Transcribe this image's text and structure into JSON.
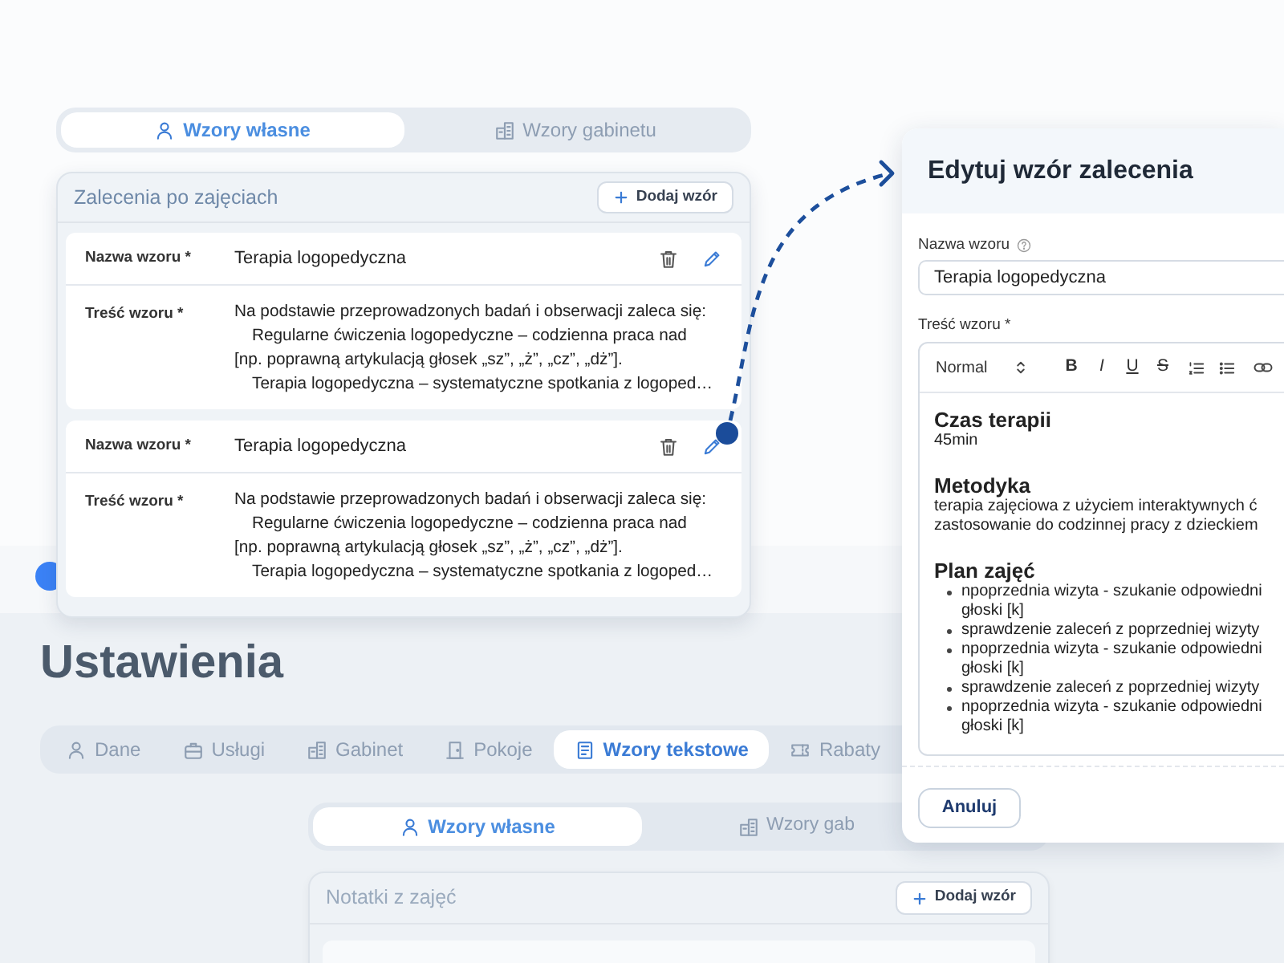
{
  "background_page": {
    "heading": "Ustawienia",
    "tabs": [
      {
        "label": "Dane",
        "selected": false
      },
      {
        "label": "Usługi",
        "selected": false
      },
      {
        "label": "Gabinet",
        "selected": false
      },
      {
        "label": "Pokoje",
        "selected": false
      },
      {
        "label": "Wzory tekstowe",
        "selected": true
      },
      {
        "label": "Rabaty",
        "selected": false
      }
    ],
    "subtabs": [
      {
        "label": "Wzory własne",
        "selected": true
      },
      {
        "label": "Wzory gab",
        "selected": false
      }
    ],
    "card": {
      "title": "Notatki z zajęć",
      "add_button": "Dodaj wzór"
    }
  },
  "template_panel": {
    "subtabs": [
      {
        "label": "Wzory własne",
        "selected": true
      },
      {
        "label": "Wzory gabinetu",
        "selected": false
      }
    ],
    "card": {
      "title": "Zalecenia po zajęciach",
      "add_button": "Dodaj wzór",
      "templates": [
        {
          "name_label": "Nazwa wzoru *",
          "name": "Terapia logopedyczna",
          "content_label": "Treść wzoru *",
          "content_lines": [
            {
              "text": "Na podstawie przeprowadzonych badań i obserwacji zaleca się:",
              "indented": false
            },
            {
              "text": "Regularne ćwiczenia logopedyczne – codzienna praca nad",
              "indented": true
            },
            {
              "text": "[np. poprawną artykulacją głosek „sz”, „ż”, „cz”, „dż”].",
              "indented": false
            },
            {
              "text": "Terapia logopedyczna – systematyczne spotkania z logoped…",
              "indented": true
            }
          ]
        },
        {
          "name_label": "Nazwa wzoru *",
          "name": "Terapia logopedyczna",
          "content_label": "Treść wzoru *",
          "content_lines": [
            {
              "text": "Na podstawie przeprowadzonych badań i obserwacji zaleca się:",
              "indented": false
            },
            {
              "text": "Regularne ćwiczenia logopedyczne – codzienna praca nad",
              "indented": true
            },
            {
              "text": "[np. poprawną artykulacją głosek „sz”, „ż”, „cz”, „dż”].",
              "indented": false
            },
            {
              "text": "Terapia logopedyczna – systematyczne spotkania z logoped…",
              "indented": true
            }
          ]
        }
      ]
    }
  },
  "edit_panel": {
    "title": "Edytuj wzór zalecenia",
    "name_label": "Nazwa wzoru",
    "name_value": "Terapia logopedyczna",
    "content_label": "Treść wzoru *",
    "toolbar": {
      "format": "Normal",
      "format_buttons": [
        {
          "label": "B",
          "kind": "bold"
        },
        {
          "label": "I",
          "kind": "italic"
        },
        {
          "label": "U",
          "kind": "underline"
        },
        {
          "label": "S",
          "kind": "strike"
        }
      ]
    },
    "content": [
      {
        "kind": "heading",
        "text": "Czas terapii"
      },
      {
        "kind": "paragraph",
        "lines": [
          "45min"
        ]
      },
      {
        "kind": "heading",
        "text": "Metodyka"
      },
      {
        "kind": "paragraph",
        "lines": [
          "terapia zajęciowa z użyciem interaktywnych ć",
          "zastosowanie do codzinnej pracy z dzieckiem"
        ]
      },
      {
        "kind": "heading",
        "text": "Plan zajęć"
      },
      {
        "kind": "bullets",
        "items": [
          {
            "lines": [
              "npoprzednia wizyta - szukanie odpowiedni",
              "głoski [k]"
            ]
          },
          {
            "lines": [
              "sprawdzenie zaleceń z poprzedniej wizyty"
            ]
          },
          {
            "lines": [
              "npoprzednia wizyta - szukanie odpowiedni",
              "głoski [k]"
            ]
          },
          {
            "lines": [
              "sprawdzenie zaleceń z poprzedniej wizyty"
            ]
          },
          {
            "lines": [
              "npoprzednia wizyta - szukanie odpowiedni",
              "głoski [k]"
            ]
          }
        ]
      }
    ],
    "cancel_button": "Anuluj"
  }
}
